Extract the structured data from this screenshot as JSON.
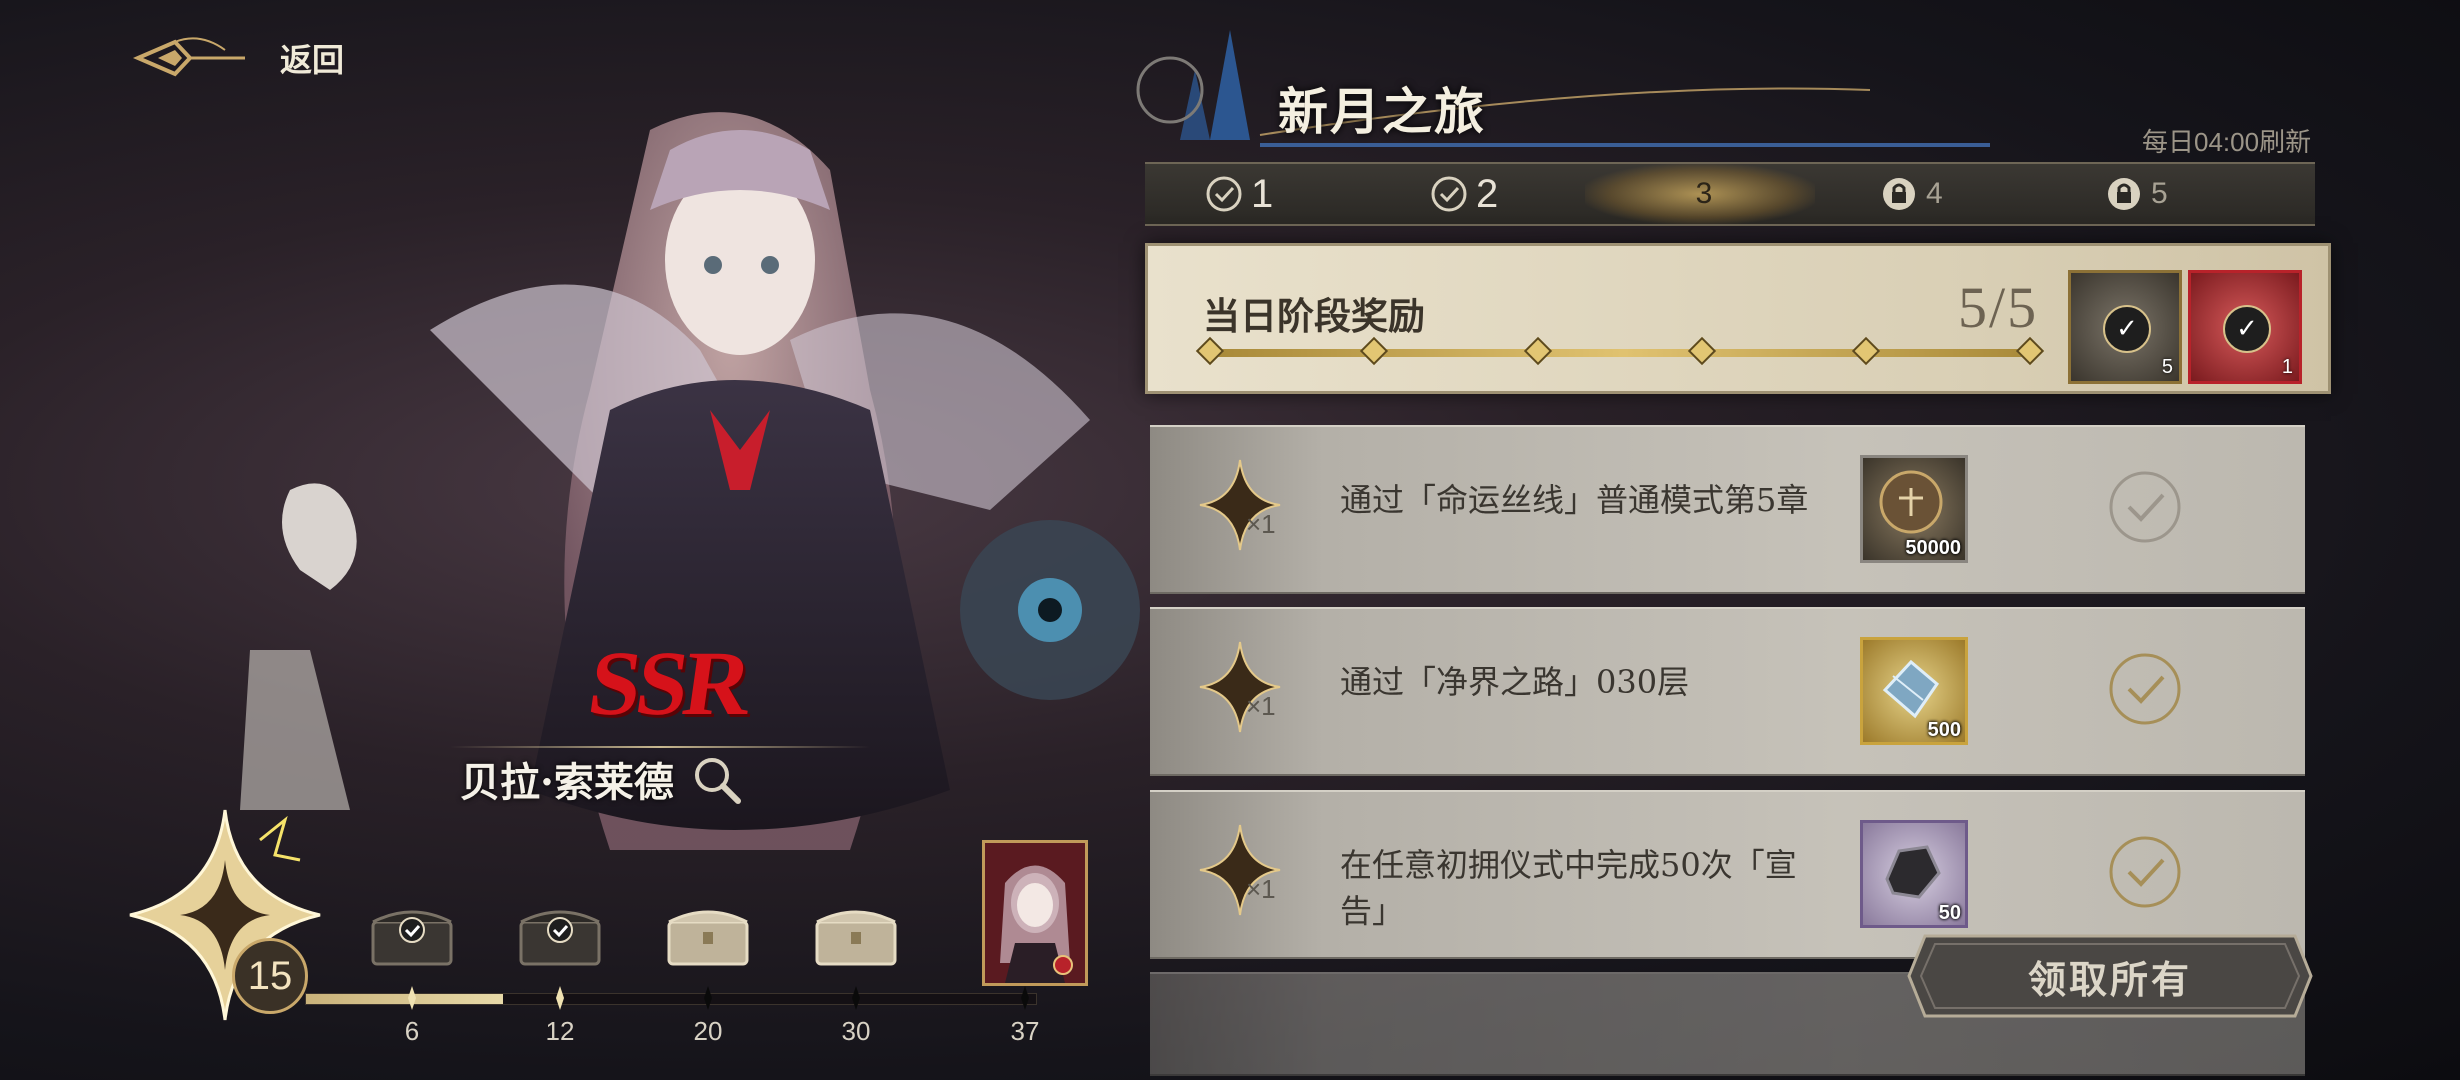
{
  "nav": {
    "back_label": "返回"
  },
  "header": {
    "title": "新月之旅",
    "refresh_text": "每日04:00刷新"
  },
  "tabs": [
    {
      "label": "1",
      "state": "completed"
    },
    {
      "label": "2",
      "state": "completed"
    },
    {
      "label": "3",
      "state": "active"
    },
    {
      "label": "4",
      "state": "locked"
    },
    {
      "label": "5",
      "state": "locked"
    }
  ],
  "daily_reward": {
    "title": "当日阶段奖励",
    "progress_text": "5/5",
    "progress_current": 5,
    "progress_total": 5,
    "rewards": [
      {
        "icon": "medal-coin-icon",
        "count": "5",
        "claimed": true,
        "rarity_color": "#b89a45"
      },
      {
        "icon": "quill-icon",
        "count": "1",
        "claimed": true,
        "rarity_color": "#b8222a"
      }
    ]
  },
  "tasks": [
    {
      "multiplier": "×1",
      "description": "通过「命运丝线」普通模式第5章",
      "reward_icon": "scale-coin-icon",
      "reward_qty": "50000",
      "frame_color": "#8a8680"
    },
    {
      "multiplier": "×1",
      "description": "通过「净界之路」030层",
      "reward_icon": "crystal-icon",
      "reward_qty": "500",
      "frame_color": "#c9a33d"
    },
    {
      "multiplier": "×1",
      "description": "在任意初拥仪式中完成50次「宣告」",
      "reward_icon": "ore-icon",
      "reward_qty": "50",
      "frame_color": "#6e5a8a"
    }
  ],
  "claim_all_label": "领取所有",
  "character": {
    "rarity": "SSR",
    "name": "贝拉·索莱德"
  },
  "progress_track": {
    "level": "15",
    "progress_fraction": 0.27,
    "milestones": [
      {
        "label": "6",
        "claimed": true
      },
      {
        "label": "12",
        "claimed": true
      },
      {
        "label": "20",
        "claimed": false
      },
      {
        "label": "30",
        "claimed": false
      },
      {
        "label": "37",
        "claimed": false
      }
    ]
  },
  "colors": {
    "accent_gold": "#c9a86a",
    "ssr_red": "#d6121a",
    "panel_light": "#e9e1cc"
  }
}
